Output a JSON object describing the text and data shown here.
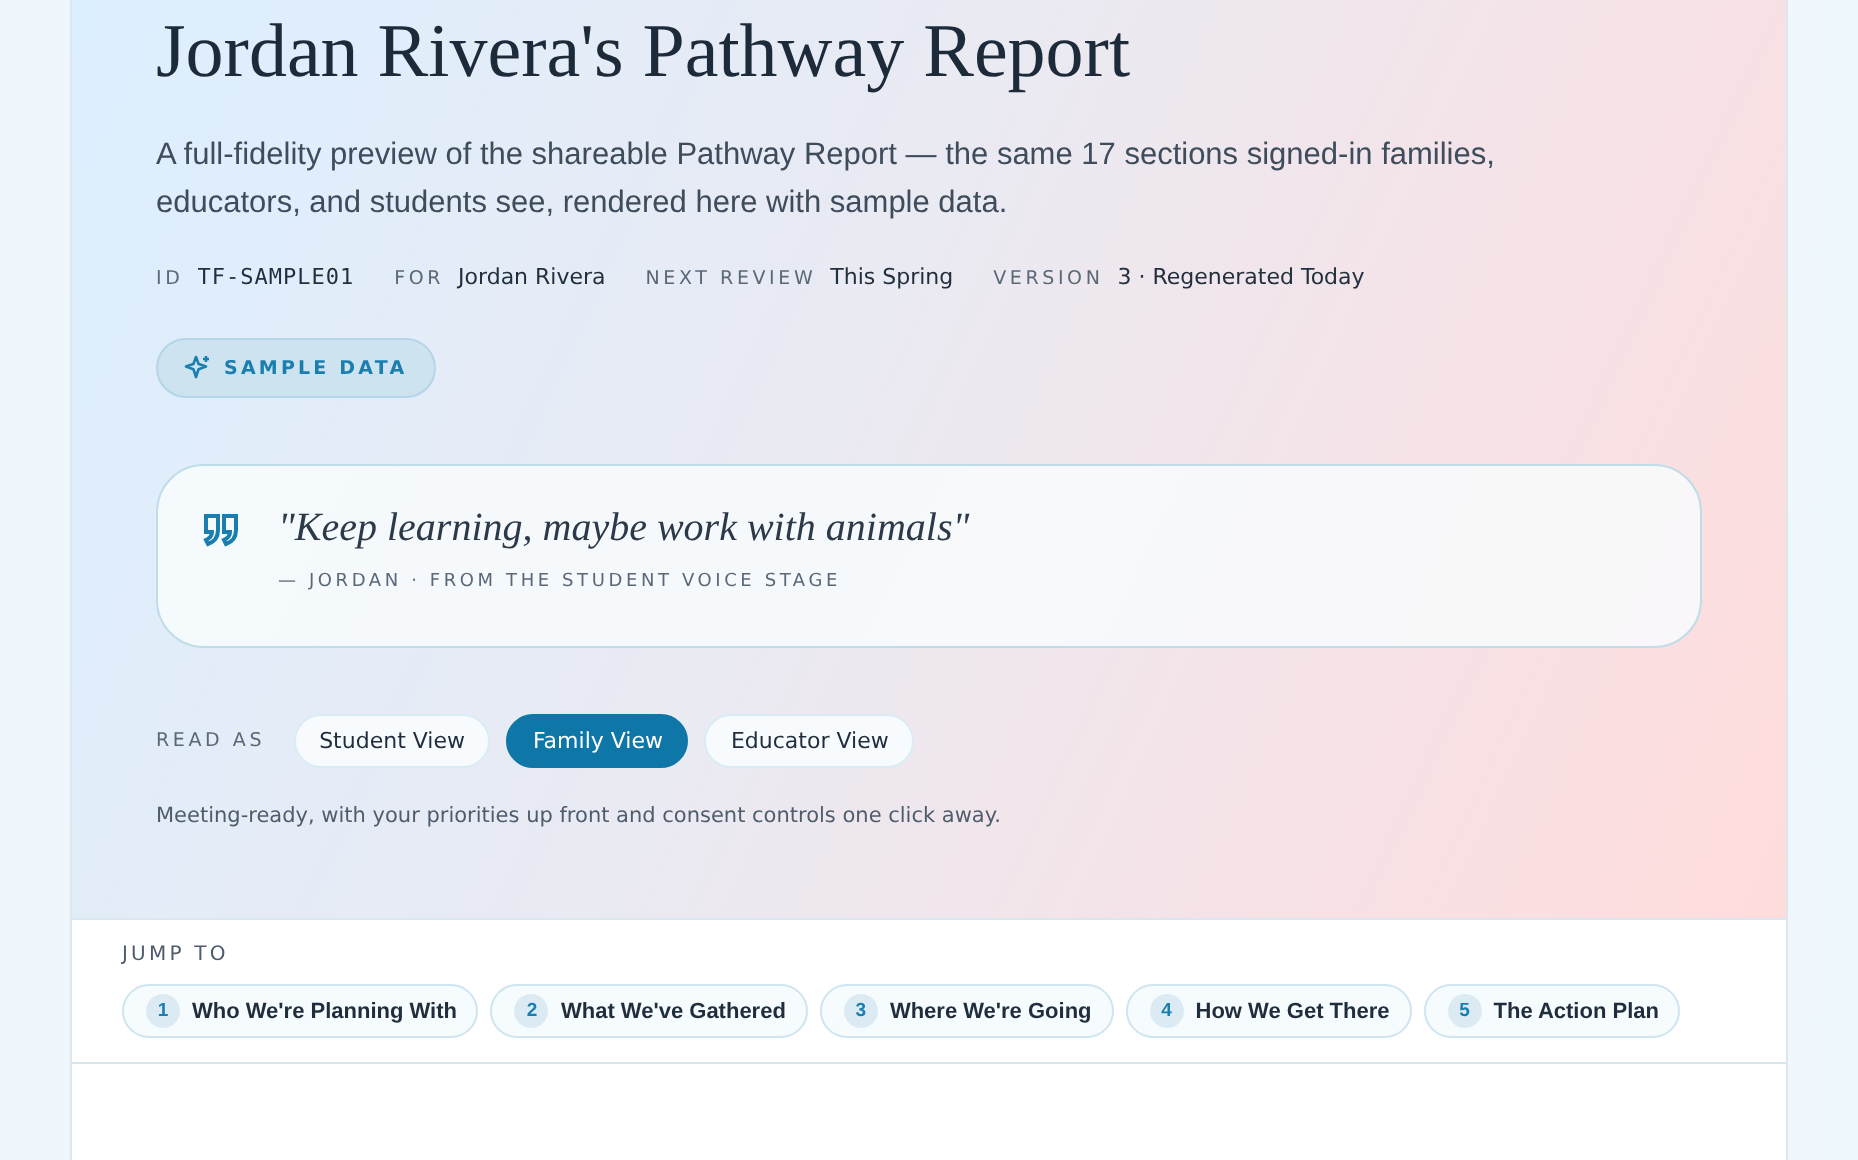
{
  "report": {
    "title": "Jordan Rivera's Pathway Report",
    "description": "A full-fidelity preview of the shareable Pathway Report — the same 17 sections signed-in families, educators, and students see, rendered here with sample data.",
    "meta": [
      {
        "label": "ID",
        "value": "TF-SAMPLE01",
        "kind": "mono"
      },
      {
        "label": "FOR",
        "value": "Jordan Rivera",
        "kind": "text"
      },
      {
        "label": "NEXT REVIEW",
        "value": "This Spring",
        "kind": "text"
      },
      {
        "label": "VERSION",
        "value": "3 · Regenerated Today",
        "kind": "text"
      }
    ],
    "badge": "SAMPLE DATA",
    "quote": {
      "text": "\"Keep learning, maybe work with animals\"",
      "attribution": "— JORDAN · FROM THE STUDENT VOICE STAGE"
    },
    "read_as": {
      "label": "READ AS",
      "views": [
        {
          "label": "Student View",
          "selected": false
        },
        {
          "label": "Family View",
          "selected": true
        },
        {
          "label": "Educator View",
          "selected": false
        }
      ],
      "note": "Meeting-ready, with your priorities up front and consent controls one click away."
    }
  },
  "jump_to": {
    "label": "JUMP TO",
    "sections": [
      {
        "number": "1",
        "label": "Who We're Planning With"
      },
      {
        "number": "2",
        "label": "What We've Gathered"
      },
      {
        "number": "3",
        "label": "Where We're Going"
      },
      {
        "number": "4",
        "label": "How We Get There"
      },
      {
        "number": "5",
        "label": "The Action Plan"
      }
    ]
  }
}
